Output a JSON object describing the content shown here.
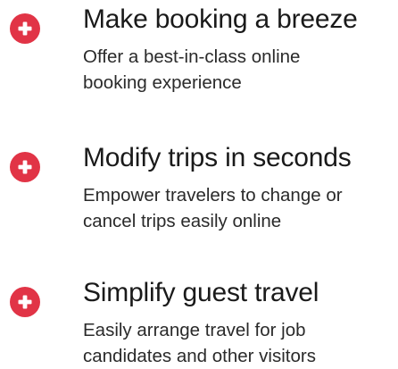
{
  "colors": {
    "icon_circle": "#e13446",
    "icon_plus": "#ffffff",
    "title_text": "#1a1a1a",
    "desc_text": "#2a2a2a"
  },
  "features": [
    {
      "icon": "plus-circle-icon",
      "title": "Make booking a breeze",
      "desc_lines": [
        "Offer a best-in-class online",
        "booking experience"
      ]
    },
    {
      "icon": "plus-circle-icon",
      "title": "Modify trips in seconds",
      "desc_lines": [
        "Empower travelers to change or",
        "cancel trips easily online"
      ]
    },
    {
      "icon": "plus-circle-icon",
      "title": "Simplify guest travel",
      "desc_lines": [
        "Easily arrange travel for job",
        "candidates and other visitors"
      ]
    }
  ]
}
